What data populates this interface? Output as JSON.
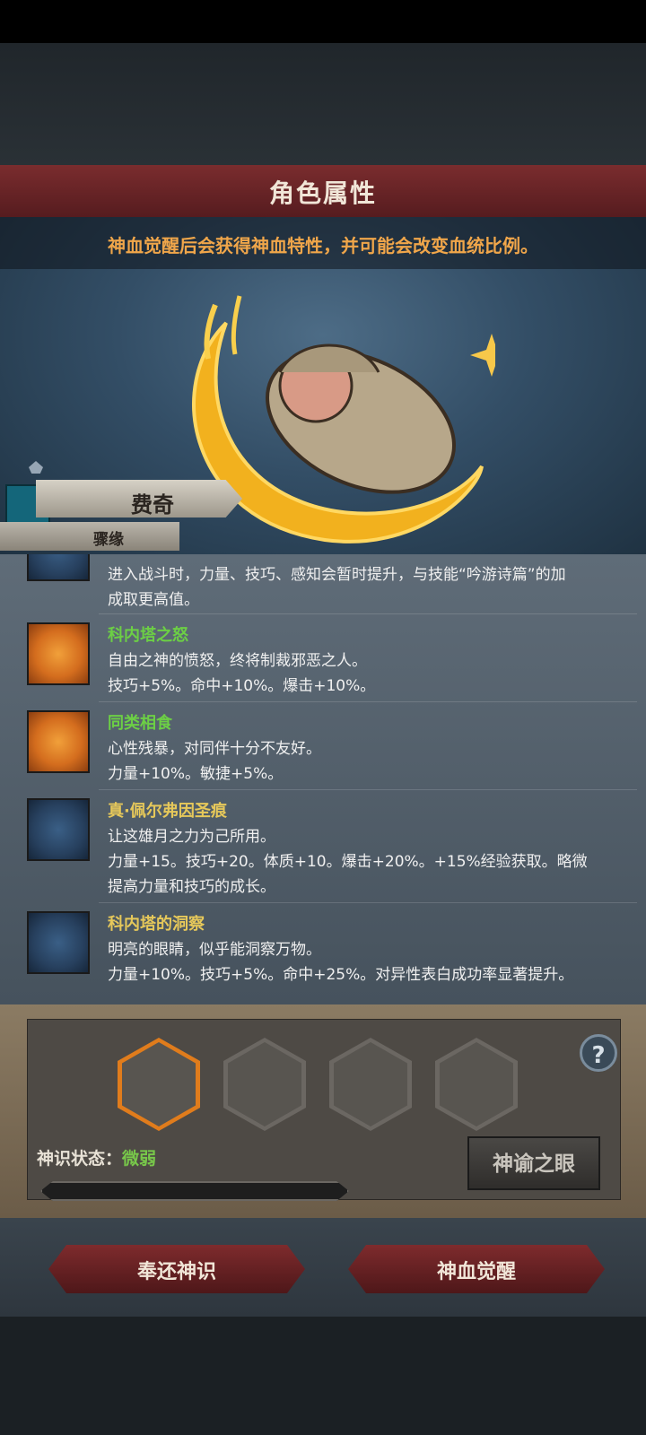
{
  "header": {
    "title": "角色属性"
  },
  "notice": "神血觉醒后会获得神血特性，并可能会改变血统比例。",
  "character": {
    "name": "费奇",
    "subtitle": "骤缘"
  },
  "traits": [
    {
      "icon": "moon-icon",
      "name": "",
      "lines": [
        "进入战斗时，力量、技巧、感知会暂时提升，与技能“吟游诗篇”的加",
        "成取更高值。"
      ],
      "name_color": "#e6c85a"
    },
    {
      "icon": "smile-icon",
      "name": "科内塔之怒",
      "lines": [
        "自由之神的愤怒，终将制裁邪恶之人。",
        "技巧+5%。命中+10%。爆击+10%。"
      ],
      "name_color": "#6ccf45"
    },
    {
      "icon": "smile-icon",
      "name": "同类相食",
      "lines": [
        "心性残暴，对同伴十分不友好。",
        "力量+10%。敏捷+5%。"
      ],
      "name_color": "#6ccf45"
    },
    {
      "icon": "moon-icon",
      "name": "真·佩尔弗因圣痕",
      "lines": [
        "让这雄月之力为己所用。",
        "力量+15。技巧+20。体质+10。爆击+20%。+15%经验获取。略微",
        "提高力量和技巧的成长。"
      ],
      "name_color": "#e6c85a"
    },
    {
      "icon": "moon-icon",
      "name": "科内塔的洞察",
      "lines": [
        "明亮的眼睛，似乎能洞察万物。",
        "力量+10%。技巧+5%。命中+25%。对异性表白成功率显著提升。"
      ],
      "name_color": "#e6c85a"
    }
  ],
  "awaken": {
    "slots": [
      {
        "type": "gold",
        "active": true
      },
      {
        "type": "gold",
        "active": false
      },
      {
        "type": "red",
        "active": false
      },
      {
        "type": "red",
        "active": false
      }
    ],
    "status_label": "神识状态：",
    "status_value": "微弱",
    "progress": 0,
    "oracle_button": "神谕之眼",
    "help": "?"
  },
  "buttons": {
    "return": "奉还神识",
    "awaken": "神血觉醒"
  },
  "colors": {
    "accent": "#f0a64a",
    "header": "#7a2c2e",
    "status_good": "#78c84a"
  }
}
